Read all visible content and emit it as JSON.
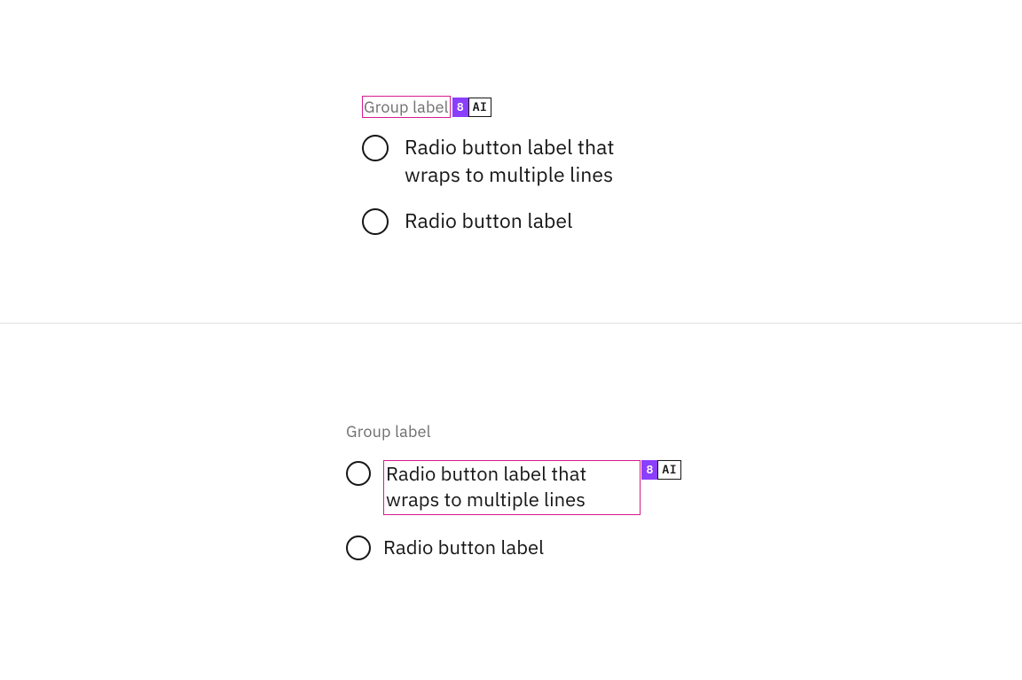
{
  "annotations": {
    "badge_number": "8",
    "badge_ai": "AI"
  },
  "example1": {
    "group_label": "Group label",
    "options": [
      {
        "label": "Radio button label that wraps to multiple lines"
      },
      {
        "label": "Radio button label"
      }
    ]
  },
  "example2": {
    "group_label": "Group label",
    "options": [
      {
        "label": "Radio button label that wraps to multiple lines"
      },
      {
        "label": "Radio button label"
      }
    ]
  }
}
